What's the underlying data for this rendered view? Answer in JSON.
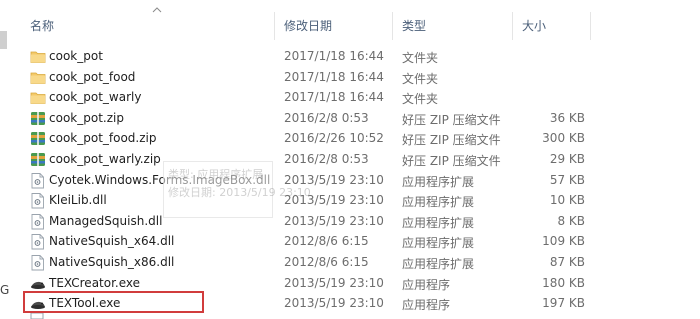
{
  "left_panel": {
    "partial_letter": "G"
  },
  "columns": {
    "name": "名称",
    "date": "修改日期",
    "type": "类型",
    "size": "大小"
  },
  "files": [
    {
      "name": "cook_pot",
      "date": "2017/1/18 16:44",
      "type": "文件夹",
      "size": "",
      "icon": "folder-icon"
    },
    {
      "name": "cook_pot_food",
      "date": "2017/1/18 16:44",
      "type": "文件夹",
      "size": "",
      "icon": "folder-icon"
    },
    {
      "name": "cook_pot_warly",
      "date": "2017/1/18 16:44",
      "type": "文件夹",
      "size": "",
      "icon": "folder-icon"
    },
    {
      "name": "cook_pot.zip",
      "date": "2016/2/8 0:53",
      "type": "好压 ZIP 压缩文件",
      "size": "36 KB",
      "icon": "zip-archive-icon"
    },
    {
      "name": "cook_pot_food.zip",
      "date": "2016/2/26 10:52",
      "type": "好压 ZIP 压缩文件",
      "size": "300 KB",
      "icon": "zip-archive-icon"
    },
    {
      "name": "cook_pot_warly.zip",
      "date": "2016/2/8 0:53",
      "type": "好压 ZIP 压缩文件",
      "size": "29 KB",
      "icon": "zip-archive-icon"
    },
    {
      "name": "Cyotek.Windows.Forms.ImageBox.dll",
      "date": "2013/5/19 23:10",
      "type": "应用程序扩展",
      "size": "57 KB",
      "icon": "dll-file-icon"
    },
    {
      "name": "KleiLib.dll",
      "date": "2013/5/19 23:10",
      "type": "应用程序扩展",
      "size": "10 KB",
      "icon": "dll-file-icon"
    },
    {
      "name": "ManagedSquish.dll",
      "date": "2013/5/19 23:10",
      "type": "应用程序扩展",
      "size": "8 KB",
      "icon": "dll-file-icon"
    },
    {
      "name": "NativeSquish_x64.dll",
      "date": "2012/8/6 6:15",
      "type": "应用程序扩展",
      "size": "109 KB",
      "icon": "dll-file-icon"
    },
    {
      "name": "NativeSquish_x86.dll",
      "date": "2012/8/6 6:15",
      "type": "应用程序扩展",
      "size": "87 KB",
      "icon": "dll-file-icon"
    },
    {
      "name": "TEXCreator.exe",
      "date": "2013/5/19 23:10",
      "type": "应用程序",
      "size": "180 KB",
      "icon": "exe-app-icon"
    },
    {
      "name": "TEXTool.exe",
      "date": "2013/5/19 23:10",
      "type": "应用程序",
      "size": "197 KB",
      "icon": "exe-app-icon"
    }
  ],
  "tooltip": {
    "line1": "类型: 应用程序扩展",
    "line2": "修改日期: 2013/5/19 23:10"
  },
  "colors": {
    "header_text": "#4c607a",
    "highlight": "#d13c3c",
    "folder": "#f3c96b",
    "zip": "#4a9a4f"
  }
}
